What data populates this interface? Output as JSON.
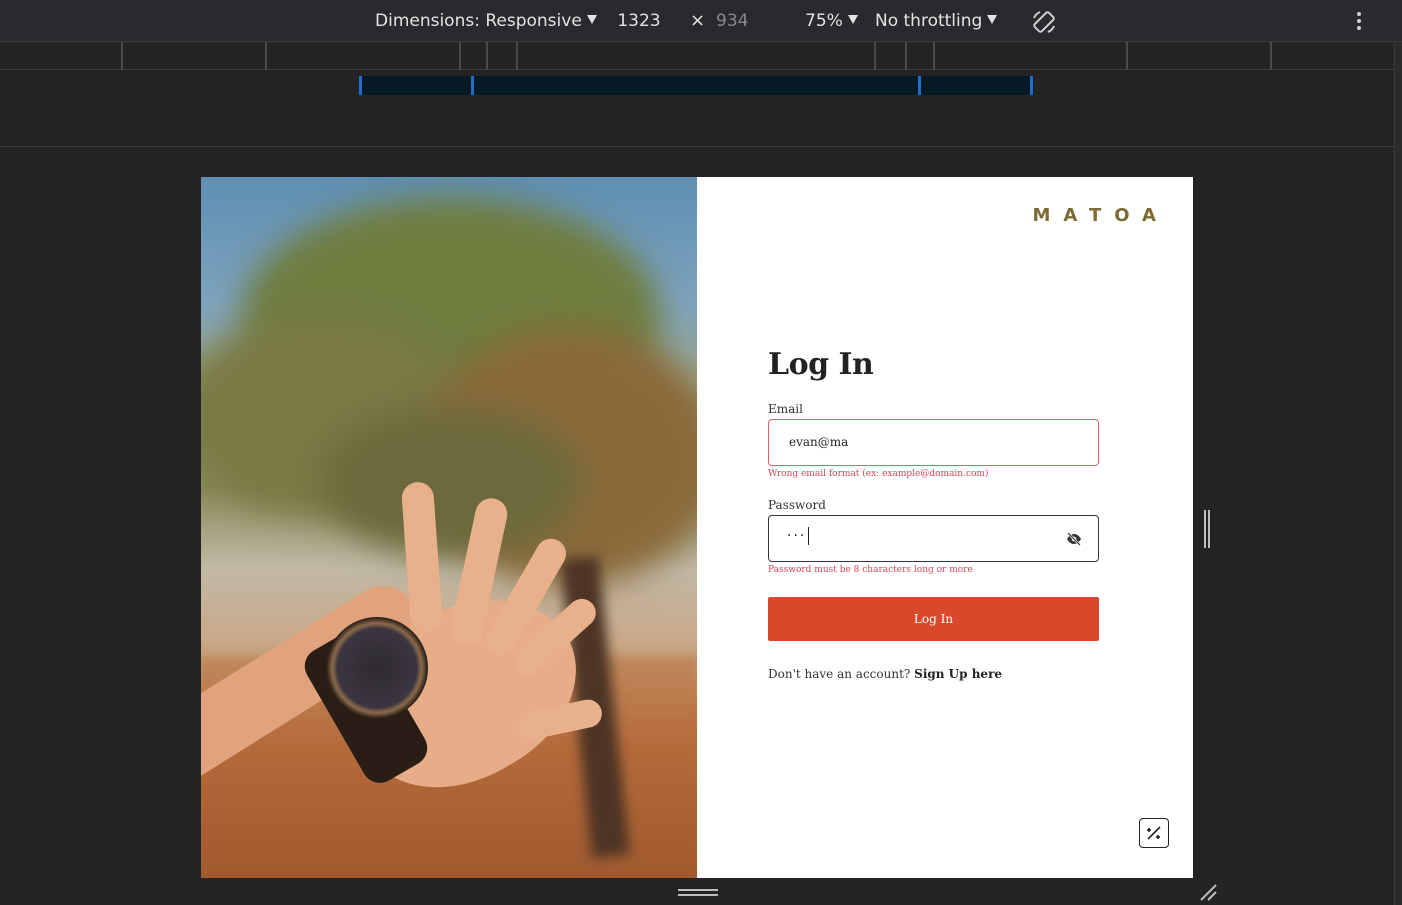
{
  "devtools": {
    "dimensions_label": "Dimensions: Responsive",
    "width": "1323",
    "times": "×",
    "height": "934",
    "zoom": "75%",
    "throttling": "No throttling"
  },
  "page": {
    "logo": "MATOA",
    "title": "Log In",
    "email_label": "Email",
    "email_value": "evan@ma",
    "email_error": "Wrong email format (ex: example@domain.com)",
    "password_label": "Password",
    "password_masked": "···",
    "password_error": "Password must be 8 characters long or more",
    "login_button": "Log In",
    "signup_prompt": "Don't have an account?",
    "signup_link": "Sign Up here"
  },
  "colors": {
    "accent": "#d9482a",
    "error": "#d9465a",
    "logo": "#7d6a35"
  }
}
